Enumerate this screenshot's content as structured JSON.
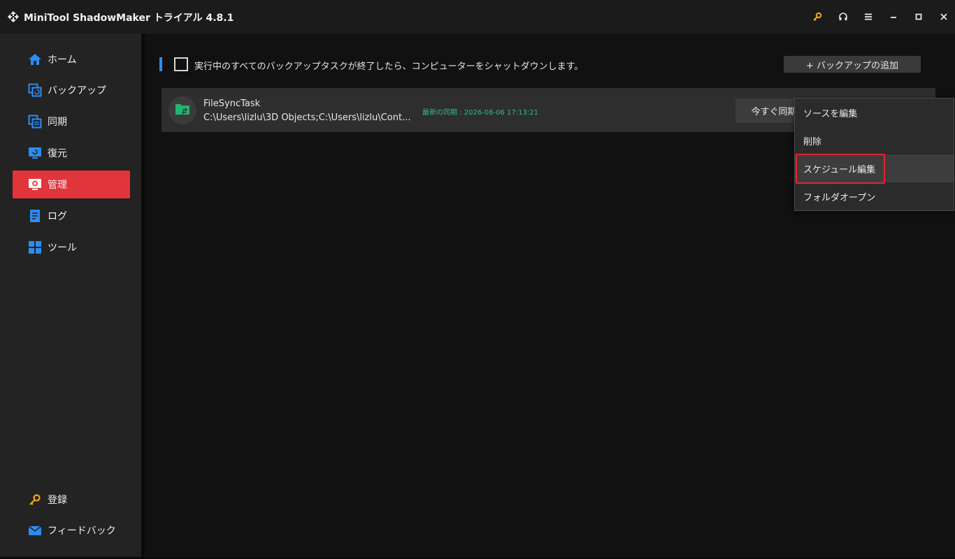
{
  "window": {
    "title": "MiniTool ShadowMaker トライアル 4.8.1",
    "icons": [
      "app-logo-icon",
      "key-icon",
      "headset-icon",
      "menu-icon",
      "minimize-icon",
      "maximize-icon",
      "close-icon"
    ]
  },
  "sidebar": {
    "items": [
      {
        "label": "ホーム",
        "icon": "home-icon"
      },
      {
        "label": "バックアップ",
        "icon": "backup-icon"
      },
      {
        "label": "同期",
        "icon": "sync-icon"
      },
      {
        "label": "復元",
        "icon": "restore-icon"
      },
      {
        "label": "管理",
        "icon": "manage-icon",
        "active": true
      },
      {
        "label": "ログ",
        "icon": "log-icon"
      },
      {
        "label": "ツール",
        "icon": "tools-icon"
      }
    ],
    "bottom_items": [
      {
        "label": "登録",
        "icon": "key-icon"
      },
      {
        "label": "フィードバック",
        "icon": "mail-icon"
      }
    ]
  },
  "main": {
    "shutdown_checkbox_label": "実行中のすべてのバックアップタスクが終了したら、コンピューターをシャットダウンします。",
    "shutdown_checked": false,
    "add_backup_label": "+ バックアップの追加"
  },
  "task": {
    "name": "FileSyncTask",
    "path": "C:\\Users\\lizlu\\3D Objects;C:\\Users\\lizlu\\Cont...",
    "last_sync": "最新の同期 : 2026-08-06 17:13:21",
    "action_label": "今すぐ同期"
  },
  "context_menu": {
    "items": [
      {
        "label": "ソースを編集"
      },
      {
        "label": "削除"
      },
      {
        "label": "スケジュール編集",
        "highlighted": true
      },
      {
        "label": "フォルダオープン"
      }
    ]
  },
  "colors": {
    "accent_active": "#e2343b",
    "accent_blue": "#2d8cf0",
    "sync_green": "#2fc07a",
    "highlight_red": "#e1262d"
  }
}
